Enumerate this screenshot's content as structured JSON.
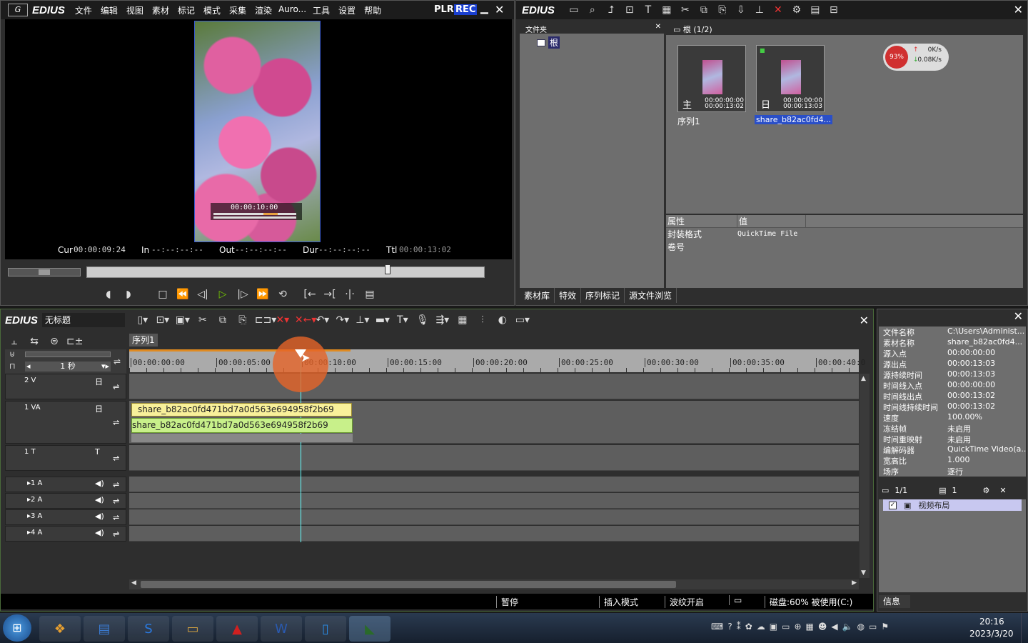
{
  "app": {
    "logo": "EDIUS",
    "menu": [
      "文件",
      "编辑",
      "视图",
      "素材",
      "标记",
      "模式",
      "采集",
      "渲染",
      "Auro...",
      "工具",
      "设置",
      "帮助"
    ],
    "plr": "PLR",
    "rec": "REC"
  },
  "player": {
    "overlay_tc": "00:00:10:00",
    "cur_label": "Cur",
    "cur": "00:00:09:24",
    "in_label": "In",
    "in": "--:--:--:--",
    "out_label": "Out",
    "out": "--:--:--:--",
    "dur_label": "Dur",
    "dur": "--:--:--:--",
    "ttl_label": "Ttl",
    "ttl": "00:00:13:02",
    "scrub_position": 0.755
  },
  "bin": {
    "logo": "EDIUS",
    "folder_header": "文件夹",
    "root": "根",
    "bin_header": "根 (1/2)",
    "clips": [
      {
        "name": "序列1",
        "tc_in": "00:00:00:00",
        "tc_out": "00:00:13:02",
        "selected": false
      },
      {
        "name": "share_b82ac0fd4...",
        "tc_in": "00:00:00:00",
        "tc_out": "00:00:13:03",
        "selected": true
      }
    ],
    "prop_header_key": "属性",
    "prop_header_val": "值",
    "props": [
      {
        "k": "封装格式",
        "v": "QuickTime File"
      },
      {
        "k": "卷号",
        "v": ""
      }
    ],
    "tabs": [
      "素材库",
      "特效",
      "序列标记",
      "源文件浏览"
    ]
  },
  "net_widget": {
    "cpu": "93%",
    "up": "0K/s",
    "down": "0.08K/s"
  },
  "timeline": {
    "logo": "EDIUS",
    "project": "无标题",
    "sequence_tab": "序列1",
    "scale": "1 秒",
    "ruler": [
      "00:00:00:00",
      "00:00:05:00",
      "00:00:10:00",
      "00:00:15:00",
      "00:00:20:00",
      "00:00:25:00",
      "00:00:30:00",
      "00:00:35:00",
      "00:00:40:0"
    ],
    "playhead_fraction": 0.235,
    "tracks": [
      {
        "name": "2 V"
      },
      {
        "name": "1 VA"
      },
      {
        "name": "1 T"
      },
      {
        "name": "1 A"
      },
      {
        "name": "2 A"
      },
      {
        "name": "3 A"
      },
      {
        "name": "4 A"
      }
    ],
    "clip_video": "share_b82ac0fd471bd7a0d563e694958f2b69",
    "clip_audio": "share_b82ac0fd471bd7a0d563e694958f2b69",
    "status": [
      "暂停",
      "插入模式",
      "波纹开启",
      "磁盘:60% 被使用(C:)"
    ]
  },
  "info": {
    "rows": [
      {
        "k": "文件名称",
        "v": "C:\\Users\\Administ..."
      },
      {
        "k": "素材名称",
        "v": "share_b82ac0fd4..."
      },
      {
        "k": "源入点",
        "v": "00:00:00:00"
      },
      {
        "k": "源出点",
        "v": "00:00:13:03"
      },
      {
        "k": "源持续时间",
        "v": "00:00:13:03"
      },
      {
        "k": "时间线入点",
        "v": "00:00:00:00"
      },
      {
        "k": "时间线出点",
        "v": "00:00:13:02"
      },
      {
        "k": "时间线持续时间",
        "v": "00:00:13:02"
      },
      {
        "k": "速度",
        "v": "100.00%"
      },
      {
        "k": "冻结帧",
        "v": "未启用"
      },
      {
        "k": "时间重映射",
        "v": "未启用"
      },
      {
        "k": "编解码器",
        "v": "QuickTime Video(a..."
      },
      {
        "k": "宽高比",
        "v": "1.000"
      },
      {
        "k": "场序",
        "v": "逐行"
      }
    ],
    "page": "1/1",
    "count": "1",
    "effect": "视频布局",
    "tab": "信息"
  },
  "taskbar": {
    "time": "20:16",
    "date": "2023/3/20"
  }
}
